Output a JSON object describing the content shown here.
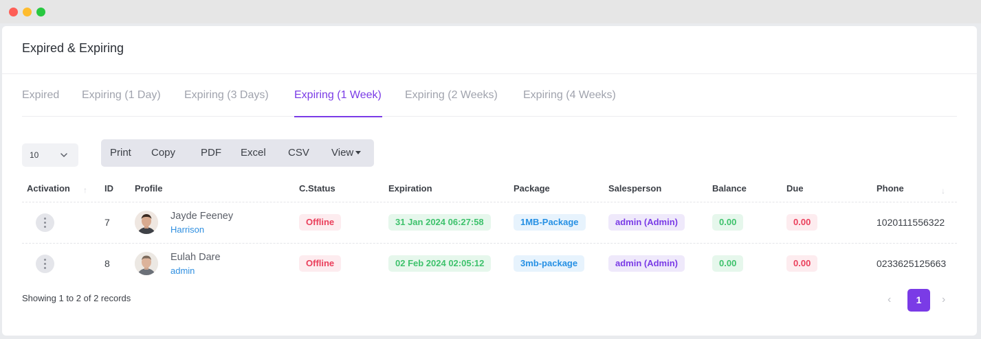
{
  "window": {
    "controls": [
      "close",
      "minimize",
      "maximize"
    ]
  },
  "page": {
    "title": "Expired & Expiring"
  },
  "tabs": [
    {
      "label": "Expired"
    },
    {
      "label": "Expiring (1 Day)"
    },
    {
      "label": "Expiring (3 Days)"
    },
    {
      "label": "Expiring (1 Week)",
      "active": true
    },
    {
      "label": "Expiring (2 Weeks)"
    },
    {
      "label": "Expiring (4 Weeks)"
    }
  ],
  "toolbar": {
    "page_length": "10",
    "print": "Print",
    "copy": "Copy",
    "pdf": "PDF",
    "excel": "Excel",
    "csv": "CSV",
    "view": "View"
  },
  "table": {
    "headers": {
      "activation": "Activation",
      "id": "ID",
      "profile": "Profile",
      "cstatus": "C.Status",
      "expiration": "Expiration",
      "package": "Package",
      "salesperson": "Salesperson",
      "balance": "Balance",
      "due": "Due",
      "phone": "Phone"
    },
    "rows": [
      {
        "id": "7",
        "name": "Jayde Feeney",
        "username": "Harrison",
        "status": "Offline",
        "expiration": "31 Jan 2024 06:27:58",
        "package": "1MB-Package",
        "salesperson": "admin (Admin)",
        "balance": "0.00",
        "due": "0.00",
        "phone": "1020111556322"
      },
      {
        "id": "8",
        "name": "Eulah Dare",
        "username": "admin",
        "status": "Offline",
        "expiration": "02 Feb 2024 02:05:12",
        "package": "3mb-package",
        "salesperson": "admin (Admin)",
        "balance": "0.00",
        "due": "0.00",
        "phone": "0233625125663"
      }
    ]
  },
  "footer": {
    "info": "Showing 1 to 2 of 2 records"
  },
  "pagination": {
    "current": "1",
    "prev_icon": "chevron-left-icon",
    "next_icon": "chevron-right-icon"
  },
  "colors": {
    "accent": "#7a3be6",
    "offline": "#ea3f5b",
    "success": "#3ec26c",
    "info": "#2690e4"
  }
}
